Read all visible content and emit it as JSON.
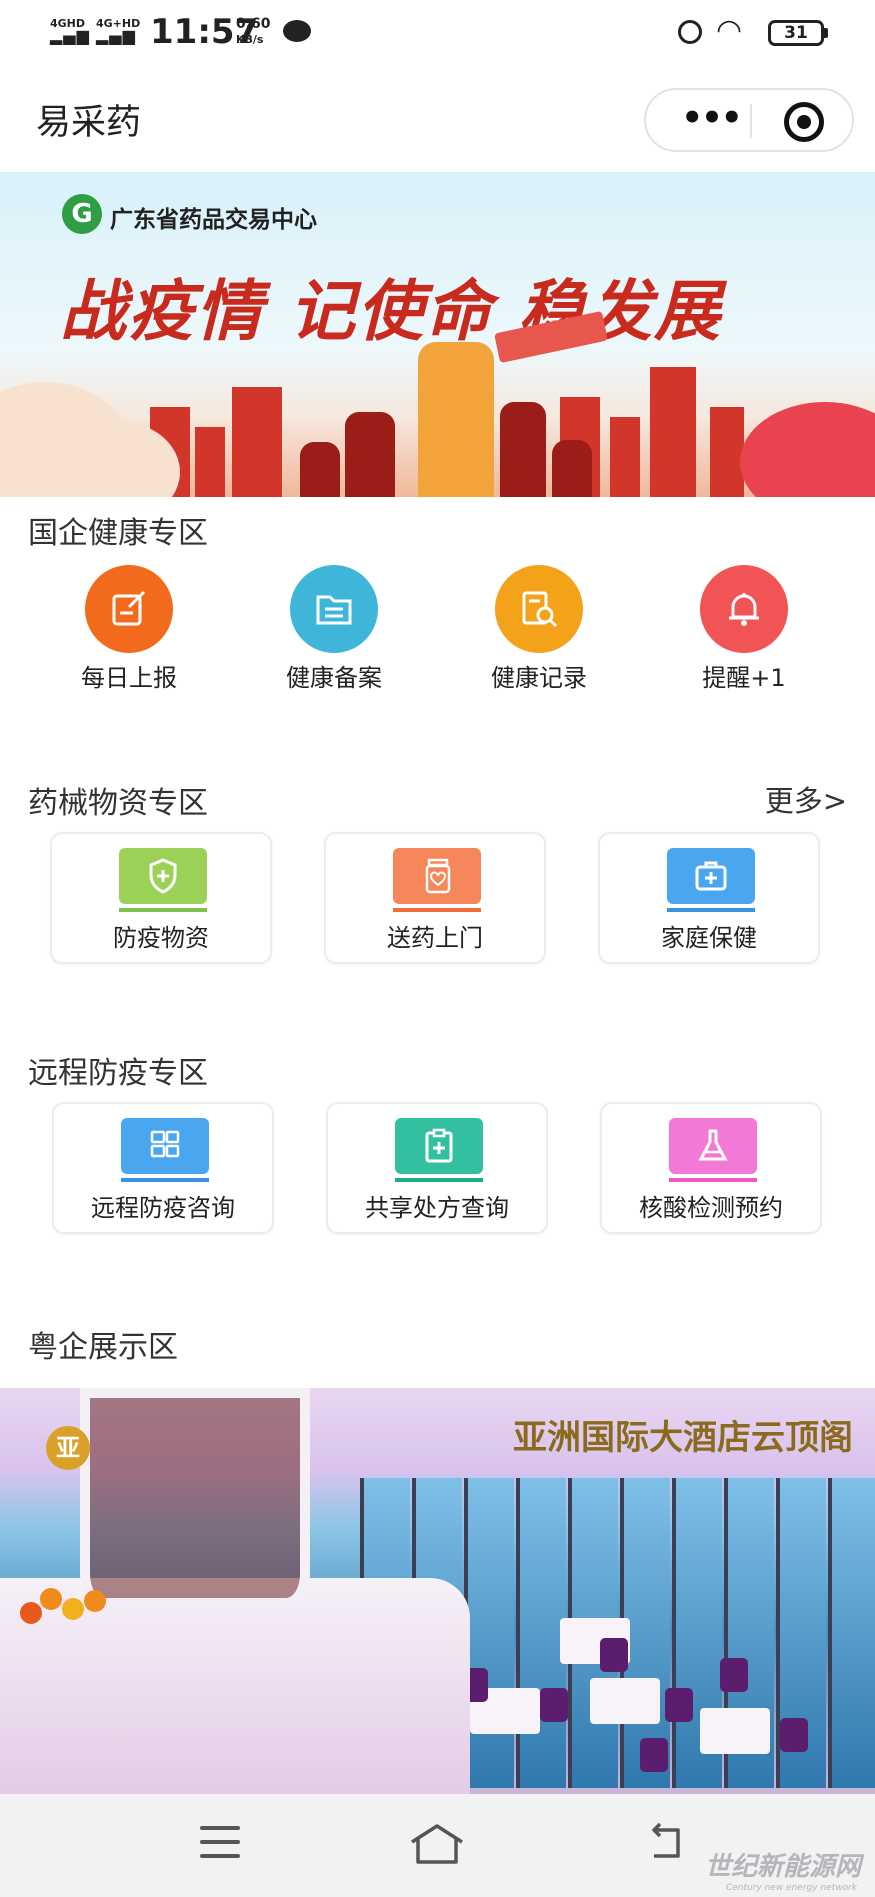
{
  "status_bar": {
    "signal1": "4GHD",
    "signal2": "4G+HD",
    "time": "11:57",
    "net_speed": "0.60",
    "net_unit": "KB/s",
    "battery": "31"
  },
  "nav": {
    "title": "易采药",
    "more_label": "•••"
  },
  "banner": {
    "org_logo_letter": "G",
    "org_name": "广东省药品交易中心",
    "slogan": "战疫情 记使命 稳发展"
  },
  "health_section": {
    "title": "国企健康专区",
    "items": [
      {
        "label": "每日上报",
        "color": "#f26b1d",
        "icon": "edit-icon"
      },
      {
        "label": "健康备案",
        "color": "#3fb6d9",
        "icon": "folder-list-icon"
      },
      {
        "label": "健康记录",
        "color": "#f4a21a",
        "icon": "document-search-icon"
      },
      {
        "label": "提醒+1",
        "color": "#f05454",
        "icon": "bell-icon"
      }
    ]
  },
  "supplies_section": {
    "title": "药械物资专区",
    "more": "更多>",
    "items": [
      {
        "label": "防疫物资",
        "color": "#9ad156",
        "bar": "#7fc24b",
        "icon": "shield-plus-icon"
      },
      {
        "label": "送药上门",
        "color": "#f5875a",
        "bar": "#ef6d3b",
        "icon": "medicine-bottle-icon"
      },
      {
        "label": "家庭保健",
        "color": "#4aa6ee",
        "bar": "#3792df",
        "icon": "medical-kit-icon"
      }
    ]
  },
  "remote_section": {
    "title": "远程防疫专区",
    "items": [
      {
        "label": "远程防疫咨询",
        "color": "#4aa6ee",
        "bar": "#3792df",
        "icon": "consult-screen-icon"
      },
      {
        "label": "共享处方查询",
        "color": "#33c0a0",
        "bar": "#22ab8a",
        "icon": "prescription-icon"
      },
      {
        "label": "核酸检测预约",
        "color": "#f27ad6",
        "bar": "#e85bc6",
        "icon": "flask-icon"
      }
    ]
  },
  "showcase_section": {
    "title": "粤企展示区",
    "hotel_name": "亚洲国际大酒店云顶阁",
    "hotel_logo": "亚"
  },
  "watermark": {
    "text": "世纪新能源网",
    "sub": "Century new energy network"
  }
}
